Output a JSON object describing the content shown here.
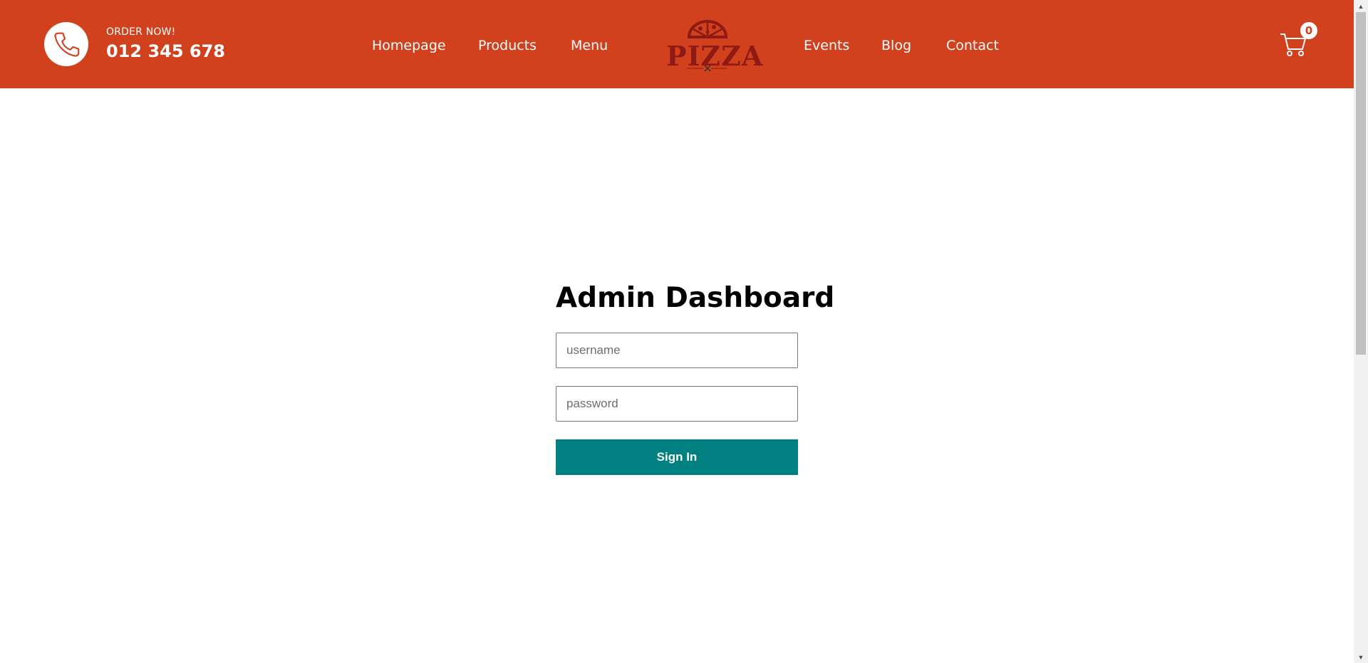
{
  "header": {
    "order_label": "ORDER NOW!",
    "order_number": "012 345 678",
    "nav_left": [
      "Homepage",
      "Products",
      "Menu"
    ],
    "nav_right": [
      "Events",
      "Blog",
      "Contact"
    ],
    "logo_text": "PIZZA",
    "cart_count": "0",
    "icons": {
      "phone": "phone-icon",
      "cart": "cart-icon"
    }
  },
  "login": {
    "title": "Admin Dashboard",
    "username_placeholder": "username",
    "password_placeholder": "password",
    "signin_label": "Sign In"
  },
  "colors": {
    "header_bg": "#d1411e",
    "button_bg": "#008080",
    "logo": "#8e1a13"
  }
}
